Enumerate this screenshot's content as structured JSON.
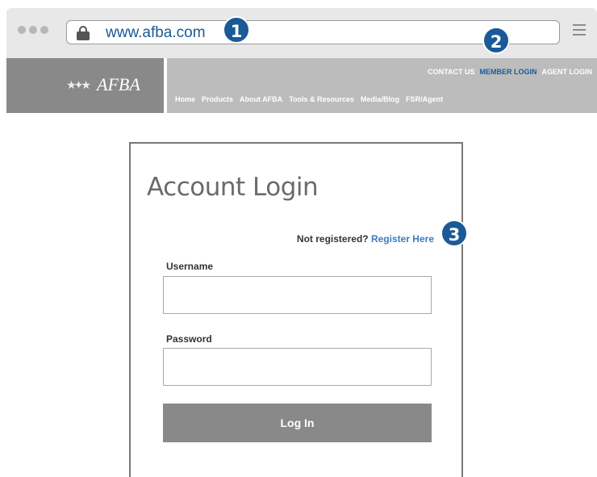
{
  "browser": {
    "url": "www.afba.com"
  },
  "callouts": [
    "1",
    "2",
    "3"
  ],
  "header": {
    "logo_text": "AFBA",
    "logo_stars": "★✦★",
    "top_links": [
      {
        "label": "CONTACT US",
        "active": false
      },
      {
        "label": "MEMBER LOGIN",
        "active": true
      },
      {
        "label": "AGENT LOGIN",
        "active": false
      }
    ],
    "main_links": [
      "Home",
      "Products",
      "About AFBA",
      "Tools & Resources",
      "Media/Blog",
      "FSR/Agent"
    ]
  },
  "login": {
    "title": "Account Login",
    "not_registered": "Not registered?",
    "register_link": "Register Here",
    "username_label": "Username",
    "username_value": "",
    "password_label": "Password",
    "password_value": "",
    "login_button": "Log In"
  },
  "colors": {
    "accent": "#1a5a96",
    "link": "#3a7bbf",
    "logo_bg": "#898989",
    "nav_bg": "#bcbcbc"
  }
}
